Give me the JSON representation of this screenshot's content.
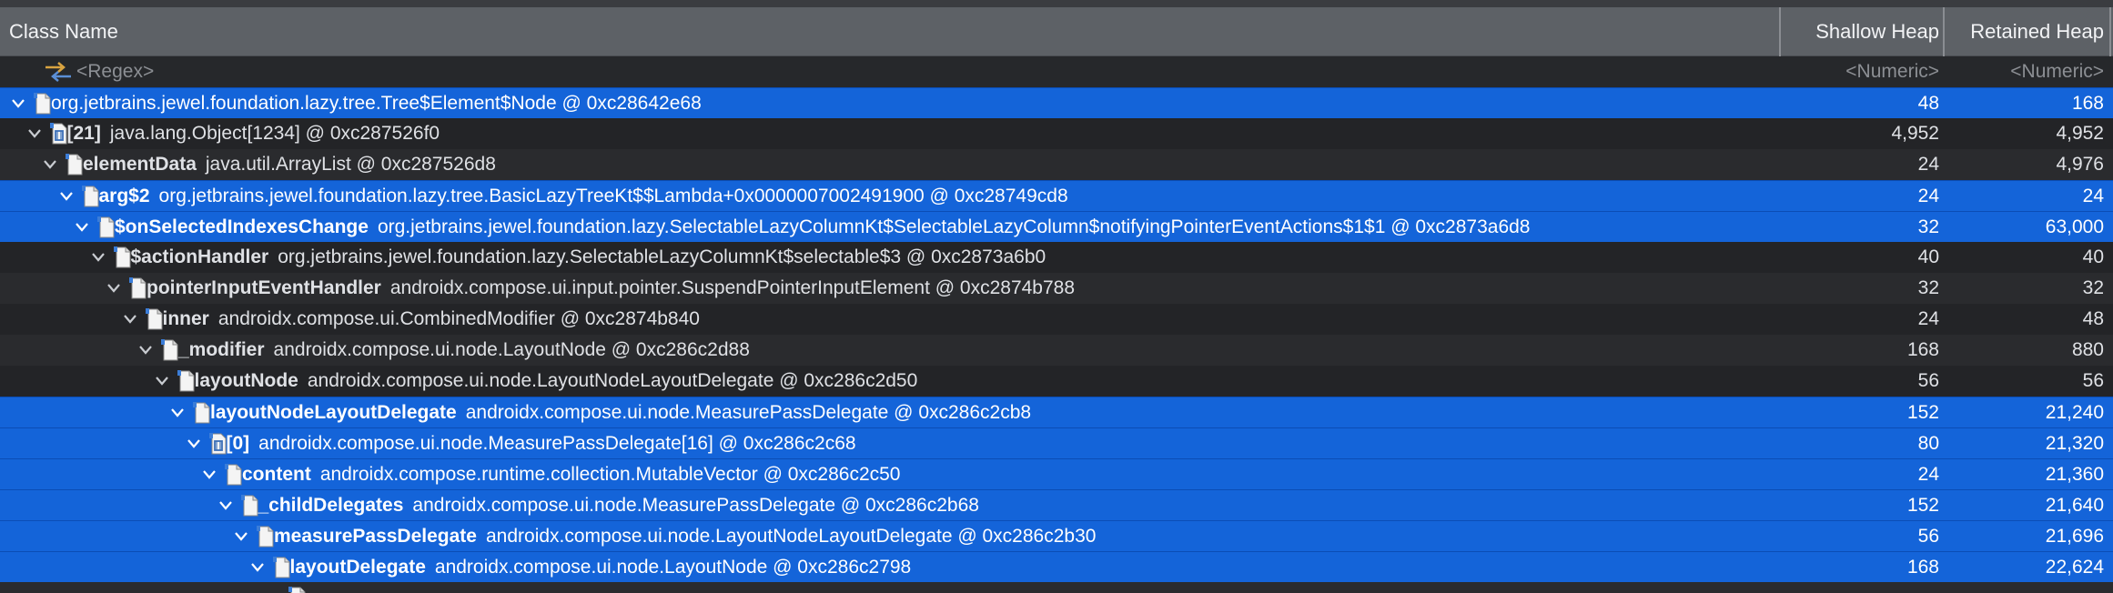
{
  "header": {
    "class_name": "Class Name",
    "shallow_heap": "Shallow Heap",
    "retained_heap": "Retained Heap"
  },
  "filter": {
    "name": "<Regex>",
    "shallow": "<Numeric>",
    "retained": "<Numeric>"
  },
  "rows": [
    {
      "depth": 0,
      "name": "",
      "type": "org.jetbrains.jewel.foundation.lazy.tree.Tree$Element$Node @ 0xc28642e68",
      "shallow": "48",
      "retained": "168",
      "selected": true,
      "icon": "file-icon"
    },
    {
      "depth": 1,
      "name": "[21]",
      "type": "java.lang.Object[1234] @ 0xc287526f0",
      "shallow": "4,952",
      "retained": "4,952",
      "selected": false,
      "icon": "array-icon"
    },
    {
      "depth": 2,
      "name": "elementData",
      "type": "java.util.ArrayList @ 0xc287526d8",
      "shallow": "24",
      "retained": "4,976",
      "selected": false,
      "icon": "file-icon"
    },
    {
      "depth": 3,
      "name": "arg$2",
      "type": "org.jetbrains.jewel.foundation.lazy.tree.BasicLazyTreeKt$$Lambda+0x0000007002491900 @ 0xc28749cd8",
      "shallow": "24",
      "retained": "24",
      "selected": true,
      "icon": "file-icon"
    },
    {
      "depth": 4,
      "name": "$onSelectedIndexesChange",
      "type": "org.jetbrains.jewel.foundation.lazy.SelectableLazyColumnKt$SelectableLazyColumn$notifyingPointerEventActions$1$1 @ 0xc2873a6d8",
      "shallow": "32",
      "retained": "63,000",
      "selected": true,
      "icon": "file-icon"
    },
    {
      "depth": 5,
      "name": "$actionHandler",
      "type": "org.jetbrains.jewel.foundation.lazy.SelectableLazyColumnKt$selectable$3 @ 0xc2873a6b0",
      "shallow": "40",
      "retained": "40",
      "selected": false,
      "icon": "file-icon"
    },
    {
      "depth": 6,
      "name": "pointerInputEventHandler",
      "type": "androidx.compose.ui.input.pointer.SuspendPointerInputElement @ 0xc2874b788",
      "shallow": "32",
      "retained": "32",
      "selected": false,
      "icon": "file-icon"
    },
    {
      "depth": 7,
      "name": "inner",
      "type": "androidx.compose.ui.CombinedModifier @ 0xc2874b840",
      "shallow": "24",
      "retained": "48",
      "selected": false,
      "icon": "file-icon"
    },
    {
      "depth": 8,
      "name": "_modifier",
      "type": "androidx.compose.ui.node.LayoutNode @ 0xc286c2d88",
      "shallow": "168",
      "retained": "880",
      "selected": false,
      "icon": "file-icon"
    },
    {
      "depth": 9,
      "name": "layoutNode",
      "type": "androidx.compose.ui.node.LayoutNodeLayoutDelegate @ 0xc286c2d50",
      "shallow": "56",
      "retained": "56",
      "selected": false,
      "icon": "file-icon"
    },
    {
      "depth": 10,
      "name": "layoutNodeLayoutDelegate",
      "type": "androidx.compose.ui.node.MeasurePassDelegate @ 0xc286c2cb8",
      "shallow": "152",
      "retained": "21,240",
      "selected": true,
      "icon": "file-icon"
    },
    {
      "depth": 11,
      "name": "[0]",
      "type": "androidx.compose.ui.node.MeasurePassDelegate[16] @ 0xc286c2c68",
      "shallow": "80",
      "retained": "21,320",
      "selected": true,
      "icon": "array-icon"
    },
    {
      "depth": 12,
      "name": "content",
      "type": "androidx.compose.runtime.collection.MutableVector @ 0xc286c2c50",
      "shallow": "24",
      "retained": "21,360",
      "selected": true,
      "icon": "file-icon"
    },
    {
      "depth": 13,
      "name": "_childDelegates",
      "type": "androidx.compose.ui.node.MeasurePassDelegate @ 0xc286c2b68",
      "shallow": "152",
      "retained": "21,640",
      "selected": true,
      "icon": "file-icon"
    },
    {
      "depth": 14,
      "name": "measurePassDelegate",
      "type": "androidx.compose.ui.node.LayoutNodeLayoutDelegate @ 0xc286c2b30",
      "shallow": "56",
      "retained": "21,696",
      "selected": true,
      "icon": "file-icon"
    },
    {
      "depth": 15,
      "name": "layoutDelegate",
      "type": "androidx.compose.ui.node.LayoutNode @ 0xc286c2798",
      "shallow": "168",
      "retained": "22,624",
      "selected": true,
      "icon": "file-icon"
    },
    {
      "depth": 16,
      "name": "",
      "type": "",
      "shallow": "",
      "retained": "",
      "selected": false,
      "icon": "file-icon"
    }
  ]
}
